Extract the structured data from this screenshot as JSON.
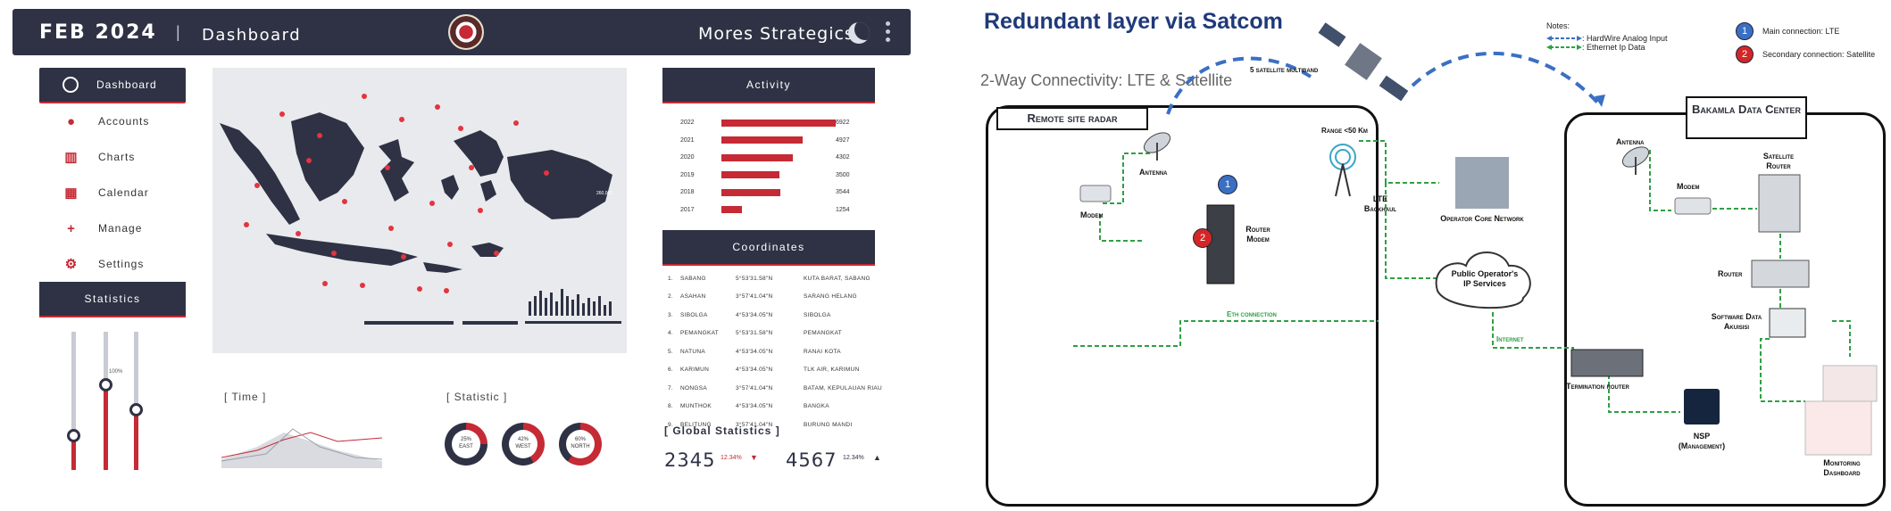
{
  "dashboard": {
    "header": {
      "date": "FEB 2024",
      "separator": "|",
      "title": "Dashboard",
      "brand": "Mores Strategics"
    },
    "nav": {
      "active": "Dashboard",
      "items": [
        "Accounts",
        "Charts",
        "Calendar",
        "Manage",
        "Settings"
      ],
      "statistics_header": "Statistics"
    },
    "sliders": [
      {
        "fill": 0.25
      },
      {
        "fill": 0.62,
        "label": "100%"
      },
      {
        "fill": 0.44
      }
    ],
    "map": {
      "badge": "260,000",
      "hot_spots": 26
    },
    "time_label": "[ Time ]",
    "statistic_label": "[ Statistic ]",
    "donuts": [
      {
        "pct": "25%",
        "region": "EAST",
        "fraction": 0.25
      },
      {
        "pct": "42%",
        "region": "WEST",
        "fraction": 0.42
      },
      {
        "pct": "60%",
        "region": "NORTH",
        "fraction": 0.6
      }
    ],
    "activity": {
      "header": "Activity",
      "rows": [
        {
          "year": "2022",
          "value": "6922",
          "n": 6922
        },
        {
          "year": "2021",
          "value": "4927",
          "n": 4927
        },
        {
          "year": "2020",
          "value": "4302",
          "n": 4302
        },
        {
          "year": "2019",
          "value": "3500",
          "n": 3500
        },
        {
          "year": "2018",
          "value": "3544",
          "n": 3544
        },
        {
          "year": "2017",
          "value": "1254",
          "n": 1254
        }
      ]
    },
    "coordinates": {
      "header": "Coordinates",
      "rows": [
        {
          "n": "1.",
          "site": "SABANG",
          "coord": "5°53'31.58\"N",
          "place": "KUTA BARAT, SABANG"
        },
        {
          "n": "2.",
          "site": "ASAHAN",
          "coord": "3°57'41.04\"N",
          "place": "SARANG HELANG"
        },
        {
          "n": "3.",
          "site": "SIBOLGA",
          "coord": "4°53'34.05\"N",
          "place": "SIBOLGA"
        },
        {
          "n": "4.",
          "site": "PEMANGKAT",
          "coord": "5°53'31.58\"N",
          "place": "PEMANGKAT"
        },
        {
          "n": "5.",
          "site": "NATUNA",
          "coord": "4°53'34.05\"N",
          "place": "RANAI KOTA"
        },
        {
          "n": "6.",
          "site": "KARIMUN",
          "coord": "4°53'34.05\"N",
          "place": "TLK AIR, KARIMUN"
        },
        {
          "n": "7.",
          "site": "NONGSA",
          "coord": "3°57'41.04\"N",
          "place": "BATAM, KEPULAUAN RIAU"
        },
        {
          "n": "8.",
          "site": "MUNTHOK",
          "coord": "4°53'34.05\"N",
          "place": "BANGKA"
        },
        {
          "n": "9.",
          "site": "BELITUNG",
          "coord": "3°57'41.04\"N",
          "place": "BURUNG MANDI"
        }
      ]
    },
    "global": {
      "label": "[ Global Statistics ]",
      "v1": "2345",
      "p1": "12.34%",
      "arrow1": "▼",
      "v2": "4567",
      "p2": "12.34%",
      "arrow2": "▲"
    }
  },
  "diagram": {
    "title": "Redundant layer via Satcom",
    "subtitle": "2-Way Connectivity:  LTE & Satellite",
    "notes": {
      "header": "Notes:",
      "hardwire": ": HardWire Analog Input",
      "ethernet": ": Ethernet Ip Data"
    },
    "legend": [
      {
        "num": "1",
        "text": "Main connection: LTE",
        "color": "#3a6fc4"
      },
      {
        "num": "2",
        "text": "Secondary connection: Satellite",
        "color": "#d42626"
      }
    ],
    "satellite_label": "5 satellite multiband",
    "remote_box": "Remote site radar",
    "center_box": "Bakamla Data Center",
    "labels": {
      "antenna_left": "Antenna",
      "modem_left": "Modem",
      "router_modem": "Router Modem",
      "range": "Range <50 Km",
      "lte_backhaul": "LTE Backhaul",
      "operator_core": "Operator Core Network",
      "public_ip": "Public Operator's IP Services",
      "eth": "Eth connection",
      "internet": "Internet",
      "antenna_right": "Antenna",
      "modem_right": "Modem",
      "satellite_router": "Satellite Router",
      "router": "Router",
      "software": "Software Data Akuisisi",
      "termination": "Termination router",
      "nsp": "NSP (Management)",
      "monitoring": "Monitoring Dashboard"
    }
  }
}
